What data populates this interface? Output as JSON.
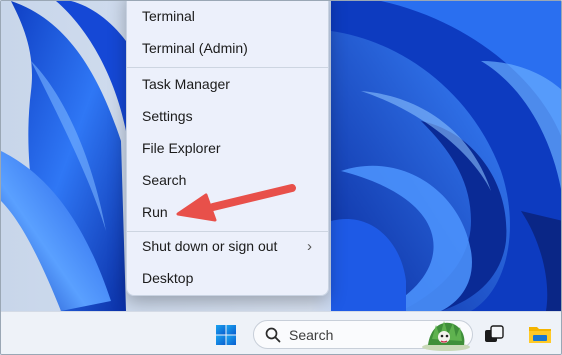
{
  "context_menu": {
    "items": [
      {
        "label": "Terminal"
      },
      {
        "label": "Terminal (Admin)"
      },
      {
        "label": "Task Manager"
      },
      {
        "label": "Settings"
      },
      {
        "label": "File Explorer"
      },
      {
        "label": "Search"
      },
      {
        "label": "Run"
      },
      {
        "label": "Shut down or sign out",
        "submenu_glyph": "›"
      },
      {
        "label": "Desktop"
      }
    ]
  },
  "taskbar": {
    "search": {
      "label": "Search",
      "icon": "search-icon"
    },
    "icons": [
      "windows-start-icon",
      "search-highlight-icon",
      "task-view-icon",
      "file-explorer-icon"
    ]
  },
  "annotation": {
    "type": "arrow",
    "target": "Run",
    "color": "#e8504a"
  },
  "colors": {
    "wallpaper_blue": "#1a5ce0",
    "menu_bg": "#ecf1fb",
    "taskbar_bg": "#eef2f8"
  }
}
